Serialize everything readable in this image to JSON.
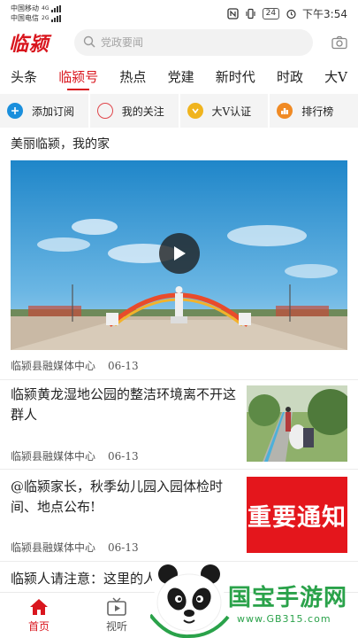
{
  "status_bar": {
    "carrier_1": "中国移动",
    "carrier_1_net": "4G",
    "carrier_2": "中国电信",
    "carrier_2_net": "2G",
    "battery": "24",
    "time": "下午3:54"
  },
  "header": {
    "logo": "临颍",
    "search_placeholder": "党政要闻"
  },
  "tabs": [
    {
      "label": "头条"
    },
    {
      "label": "临颍号"
    },
    {
      "label": "热点"
    },
    {
      "label": "党建"
    },
    {
      "label": "新时代"
    },
    {
      "label": "时政"
    },
    {
      "label": "大V"
    }
  ],
  "quick_actions": [
    {
      "label": "添加订阅",
      "icon": "plus-icon",
      "color": "#1a8fdc"
    },
    {
      "label": "我的关注",
      "icon": "circle-icon",
      "color": "#e0474c"
    },
    {
      "label": "大V认证",
      "icon": "check-icon",
      "color": "#f0b41e"
    },
    {
      "label": "排行榜",
      "icon": "podium-icon",
      "color": "#f08a24"
    }
  ],
  "section": {
    "title": "美丽临颍，我的家"
  },
  "featured": {
    "source": "临颍县融媒体中心",
    "date": "06-13"
  },
  "news": [
    {
      "title": "临颍黄龙湿地公园的整洁环境离不开这群人",
      "source": "临颍县融媒体中心",
      "date": "06-13"
    },
    {
      "title": "@临颍家长，秋季幼儿园入园体检时间、地点公布!",
      "source": "临颍县融媒体中心",
      "date": "06-13",
      "thumb_text": "重要通知"
    },
    {
      "title": "临颍人请注意：这里的人"
    }
  ],
  "bottom_nav": [
    {
      "label": "首页"
    },
    {
      "label": "视听"
    }
  ],
  "watermark": {
    "title": "国宝手游网",
    "url": "www.GB315.com"
  },
  "colors": {
    "brand_red": "#d9161e",
    "notice_red": "#e4161c",
    "watermark_green": "#2aa24a"
  }
}
